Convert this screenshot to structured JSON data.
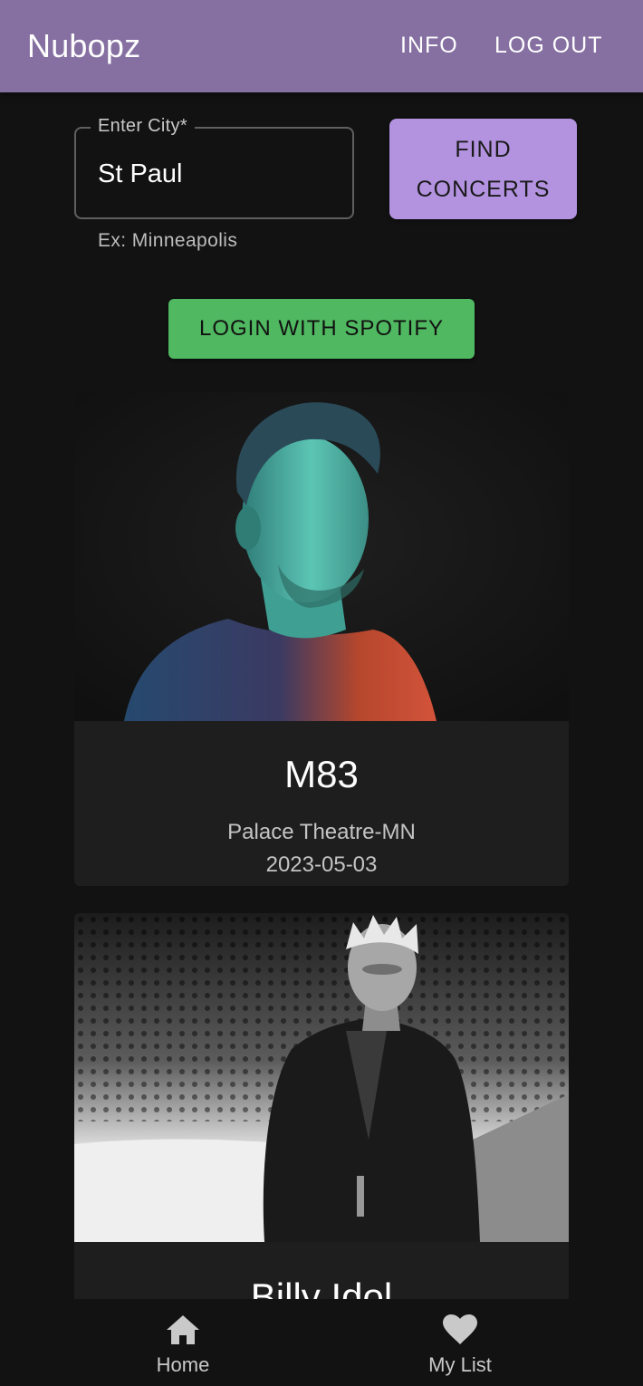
{
  "app": {
    "title": "Nubopz",
    "nav": {
      "info": "INFO",
      "logout": "LOG OUT"
    }
  },
  "search": {
    "label": "Enter City",
    "required_mark": "*",
    "value": "St Paul",
    "helper": "Ex: Minneapolis",
    "find_line1": "FIND",
    "find_line2": "CONCERTS"
  },
  "spotify": {
    "label": "LOGIN WITH SPOTIFY"
  },
  "concerts": [
    {
      "artist": "M83",
      "venue": "Palace Theatre-MN",
      "date": "2023-05-03"
    },
    {
      "artist": "Billy Idol"
    }
  ],
  "bottom_nav": {
    "home": {
      "label": "Home",
      "icon": "home-icon"
    },
    "list": {
      "label": "My List",
      "icon": "heart-icon"
    }
  },
  "colors": {
    "appbar": "#8670a2",
    "find_button": "#b393e0",
    "spotify_button": "#4fb860",
    "background": "#121212",
    "card": "#1e1e1e"
  }
}
